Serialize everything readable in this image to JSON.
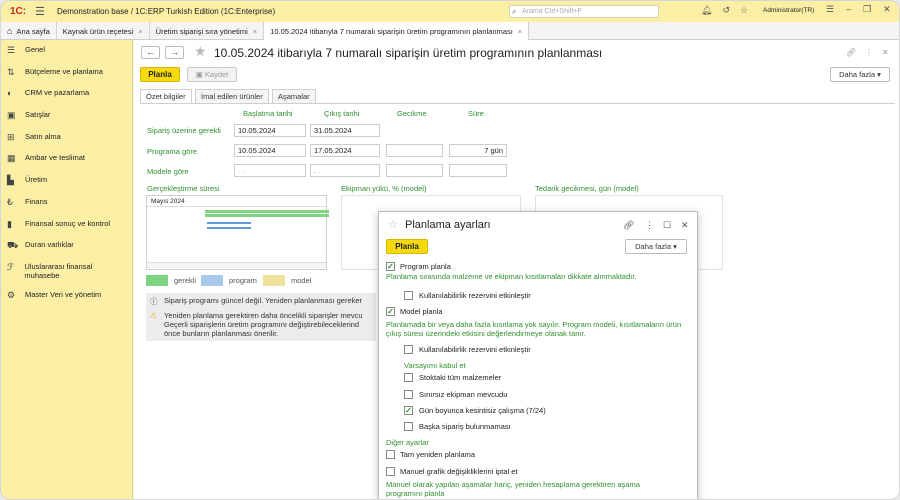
{
  "topbar": {
    "logo": "1C:",
    "app_title": "Demonstration base / 1C:ERP Turkish Edition  (1C:Enterprise)",
    "search_placeholder": "Arama Ctrl+Shift+F",
    "user": "Administrator(TR)"
  },
  "tabs": [
    {
      "label": "Ana sayfa"
    },
    {
      "label": "Kaynak ürün reçetesi"
    },
    {
      "label": "Üretim siparişi sıra yönetimi"
    },
    {
      "label": "10.05.2024 itibarıyla 7 numaralı siparişin üretim programının planlanması"
    }
  ],
  "sidebar": {
    "items": [
      {
        "label": "Genel",
        "icon": "menu-icon"
      },
      {
        "label": "Bütçeleme ve planlama",
        "icon": "budget-icon"
      },
      {
        "label": "CRM ve pazarlama",
        "icon": "crm-icon"
      },
      {
        "label": "Satışlar",
        "icon": "sales-icon"
      },
      {
        "label": "Satın alma",
        "icon": "purchase-icon"
      },
      {
        "label": "Ambar ve teslimat",
        "icon": "warehouse-icon"
      },
      {
        "label": "Üretim",
        "icon": "production-icon"
      },
      {
        "label": "Finans",
        "icon": "finance-icon"
      },
      {
        "label": "Finansal sonuç ve kontrol",
        "icon": "chart-icon"
      },
      {
        "label": "Duran varlıklar",
        "icon": "asset-icon"
      },
      {
        "label": "Uluslararası finansal muhasebe",
        "icon": "ifrs-icon"
      },
      {
        "label": "Master Veri ve yönetim",
        "icon": "gear-icon"
      }
    ]
  },
  "doc": {
    "title": "10.05.2024 itibarıyla 7 numaralı siparişin üretim programının planlanması",
    "btn_plan": "Planla",
    "btn_save": "Kaydet",
    "btn_more": "Daha fazla",
    "form_tabs": [
      "Özet bilgiler",
      "İmal edilen ürünler",
      "Aşamalar"
    ],
    "columns": [
      "Başlatma tarihi",
      "Çıkış tarihi",
      "Gecikme",
      "Süre"
    ],
    "rows": [
      {
        "label": "Sipariş üzerine gerekli",
        "start": "10.05.2024",
        "end": "31.05.2024",
        "delay": "",
        "duration": ""
      },
      {
        "label": "Programa göre",
        "start": "10.05.2024",
        "end": "17.05.2024",
        "delay": "",
        "duration": "7 gün"
      },
      {
        "label": "Modele göre",
        "start": " .  .",
        "end": " .  .",
        "delay": "",
        "duration": ""
      }
    ],
    "sections": [
      "Gerçekleştirme süresi",
      "Ekipman yükü, % (model)",
      "Tedarik gecikmesi, gün (model)"
    ],
    "gantt_month": "Mayıs 2024",
    "legend": [
      "gerekli",
      "program",
      "model"
    ],
    "info1": "Sipariş programı güncel değil. Yeniden planlanması gereker",
    "warn": [
      "Yeniden planlama gerektiren daha öncelikli siparişler mevcu",
      "Geçerli siparişlerin üretim programını değiştirebileceklerind",
      "önce bunların planlanması önerilir."
    ]
  },
  "popup": {
    "title": "Planlama ayarları",
    "btn_plan": "Planla",
    "btn_more": "Daha fazla",
    "program_label": "Program planla",
    "program_note": "Planlama sırasında malzeme ve ekipman kısıtlamaları dikkate alınmaktadır.",
    "reserve_label1": "Kullanılabilirlik rezervini etkinleştir",
    "model_label": "Model planla",
    "model_note": "Planlamada bir veya daha fazla kısıtlama yok sayılır. Program modeli, kısıtlamaların ürün çıkış süresi üzerindeki etkisini değerlendirmeye olanak tanır.",
    "reserve_label2": "Kullanılabilirlik rezervini etkinleştir",
    "assume_group": "Varsayımı kabul et",
    "assume": [
      "Stoktaki tüm malzemeler",
      "Sınırsız ekipman mevcudu",
      "Gün boyunca kesintisiz çalışma (7/24)",
      "Başka sipariş bulunmaması"
    ],
    "other_group": "Diğer ayarlar",
    "full_replan": "Tam yeniden planlama",
    "cancel_manual": "Manuel grafik değişikliklerini iptal et",
    "bottom_note": "Manuel olarak yapılan aşamalar hariç, yeniden hesaplama gerektiren aşama programını planla"
  },
  "colors": {
    "accent": "#f5d90c",
    "sidebar": "#fbeea5",
    "green_label": "#2f8f2f",
    "required": "#7ed37e",
    "program": "#a9c8ea",
    "model": "#efe29d"
  }
}
